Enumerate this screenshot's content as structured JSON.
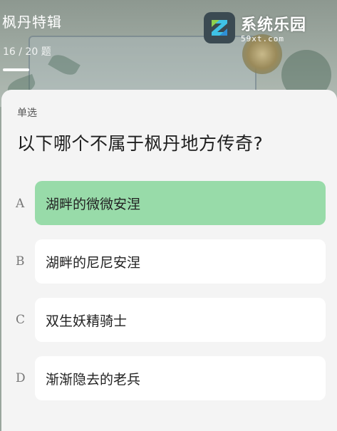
{
  "header": {
    "title": "枫丹特辑",
    "progress": "16 / 20 题",
    "progress_fraction": 0.8
  },
  "watermark": {
    "name": "系统乐园",
    "url": "59xt.com"
  },
  "quiz": {
    "type_label": "单选",
    "question": "以下哪个不属于枫丹地方传奇?",
    "selected": "A",
    "options": [
      {
        "letter": "A",
        "text": "湖畔的微微安涅"
      },
      {
        "letter": "B",
        "text": "湖畔的尼尼安涅"
      },
      {
        "letter": "C",
        "text": "双生妖精骑士"
      },
      {
        "letter": "D",
        "text": "渐渐隐去的老兵"
      }
    ]
  },
  "colors": {
    "selected_option": "#98dba9",
    "option_bg": "#ffffff",
    "card_bg": "#f4f4f4"
  }
}
